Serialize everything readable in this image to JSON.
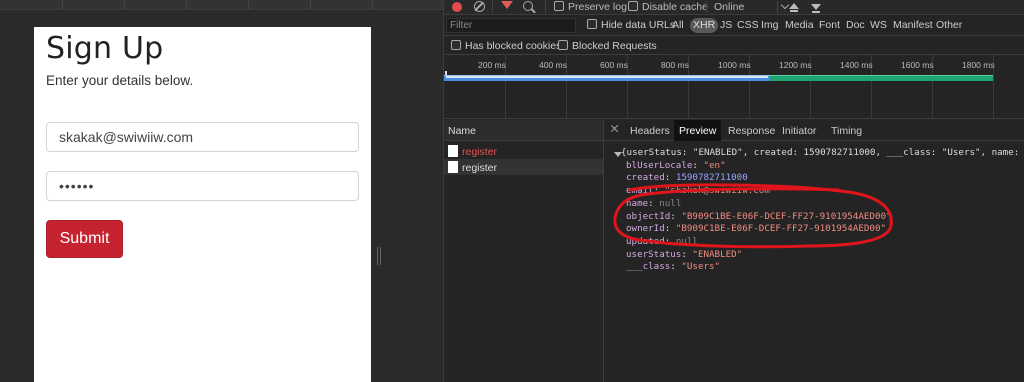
{
  "signup": {
    "title": "Sign Up",
    "subtitle": "Enter your details below.",
    "email_value": "skakak@swiwiiw.com",
    "password_mask": "••••••",
    "submit_label": "Submit"
  },
  "devtools": {
    "toolbar": {
      "preserve_log": "Preserve log",
      "disable_cache": "Disable cache",
      "throttling": "Online"
    },
    "filter_bar": {
      "filter_placeholder": "Filter",
      "hide_data_urls": "Hide data URLs",
      "types": [
        "All",
        "XHR",
        "JS",
        "CSS",
        "Img",
        "Media",
        "Font",
        "Doc",
        "WS",
        "Manifest",
        "Other"
      ],
      "active_type": "XHR"
    },
    "options_bar": {
      "has_blocked_cookies": "Has blocked cookies",
      "blocked_requests": "Blocked Requests"
    },
    "timeline_ticks": [
      "200 ms",
      "400 ms",
      "600 ms",
      "800 ms",
      "1000 ms",
      "1200 ms",
      "1400 ms",
      "1600 ms",
      "1800 ms"
    ],
    "name_header": "Name",
    "requests": [
      {
        "name": "register",
        "status": "failed"
      },
      {
        "name": "register",
        "status": "selected"
      }
    ],
    "tabs": [
      "Headers",
      "Preview",
      "Response",
      "Initiator",
      "Timing"
    ],
    "active_tab": "Preview",
    "preview": {
      "summary": "{userStatus: \"ENABLED\", created: 1590782711000, ___class: \"Users\", name: null,",
      "fields": [
        {
          "key": "blUserLocale",
          "value": "\"en\"",
          "type": "string"
        },
        {
          "key": "created",
          "value": "1590782711000",
          "type": "number"
        },
        {
          "key": "email",
          "value": "\"skakak@swiwiiw.com\"",
          "type": "string"
        },
        {
          "key": "name",
          "value": "null",
          "type": "null"
        },
        {
          "key": "objectId",
          "value": "\"B909C1BE-E06F-DCEF-FF27-9101954AED00\"",
          "type": "string"
        },
        {
          "key": "ownerId",
          "value": "\"B909C1BE-E06F-DCEF-FF27-9101954AED00\"",
          "type": "string"
        },
        {
          "key": "updated",
          "value": "null",
          "type": "null"
        },
        {
          "key": "userStatus",
          "value": "\"ENABLED\"",
          "type": "string"
        },
        {
          "key": "___class",
          "value": "\"Users\"",
          "type": "string"
        }
      ]
    }
  },
  "colors": {
    "annotation_red": "#e0141b",
    "submit_bg": "#c4232f",
    "record_red": "#e34c4c"
  }
}
